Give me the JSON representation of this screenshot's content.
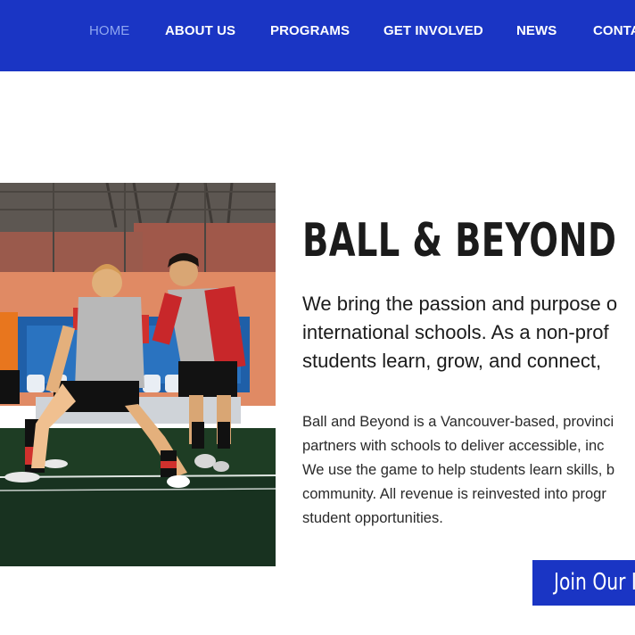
{
  "nav": {
    "items": [
      {
        "label": "HOME",
        "active": true
      },
      {
        "label": "ABOUT US",
        "active": false
      },
      {
        "label": "PROGRAMS",
        "active": false
      },
      {
        "label": "GET INVOLVED",
        "active": false
      },
      {
        "label": "NEWS",
        "active": false
      },
      {
        "label": "CONTA",
        "active": false
      }
    ]
  },
  "hero": {
    "title": "BALL & BEYOND",
    "lead_lines": [
      "We bring the passion and purpose o",
      "international schools. As a non-prof",
      "students learn, grow, and connect,"
    ],
    "body_lines": [
      "Ball and Beyond is a Vancouver-based, provinci",
      "partners with schools to deliver accessible, inc",
      "We use the game to help students learn skills, b",
      "community. All revenue is reinvested into progr",
      "student opportunities."
    ],
    "cta_label": "Join Our I"
  },
  "colors": {
    "brand_blue": "#1a35c4",
    "active_nav": "#8fa6f0",
    "text_dark": "#1b1b1b"
  }
}
